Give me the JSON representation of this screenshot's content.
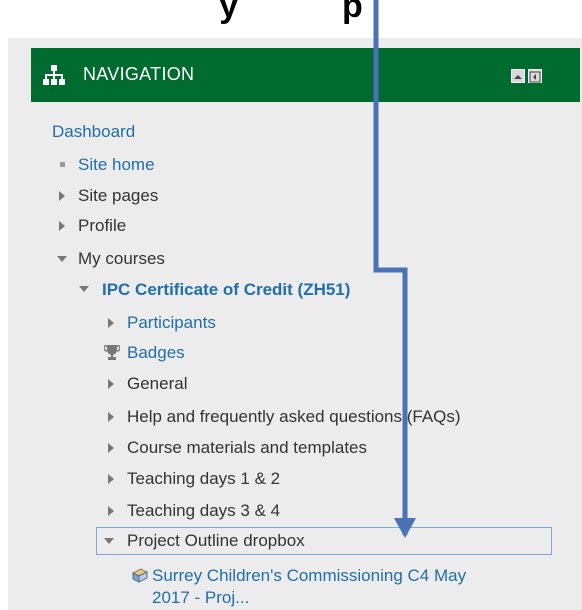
{
  "top_caption": "y           p",
  "navigation": {
    "title": "NAVIGATION",
    "items": [
      {
        "label": "Dashboard"
      },
      {
        "label": "Site home"
      },
      {
        "label": "Site pages"
      },
      {
        "label": "Profile"
      },
      {
        "label": "My courses"
      },
      {
        "label": "IPC Certificate of Credit (ZH51)"
      },
      {
        "label": "Participants"
      },
      {
        "label": "Badges"
      },
      {
        "label": "General"
      },
      {
        "label": "Help and frequently asked questions (FAQs)"
      },
      {
        "label": "Course materials and templates"
      },
      {
        "label": "Teaching days 1 & 2"
      },
      {
        "label": "Teaching days 3 & 4"
      },
      {
        "label": "Project Outline dropbox"
      },
      {
        "label": "Surrey Children's Commissioning C4 May"
      },
      {
        "label": "2017 - Proj..."
      }
    ]
  },
  "colors": {
    "header_bg": "#006b2e",
    "link": "#1f6fa8",
    "arrow": "#4a73b5"
  },
  "icons": [
    "sitemap-icon",
    "collapse-icon",
    "dock-icon",
    "trophy-icon",
    "assignment-icon"
  ]
}
